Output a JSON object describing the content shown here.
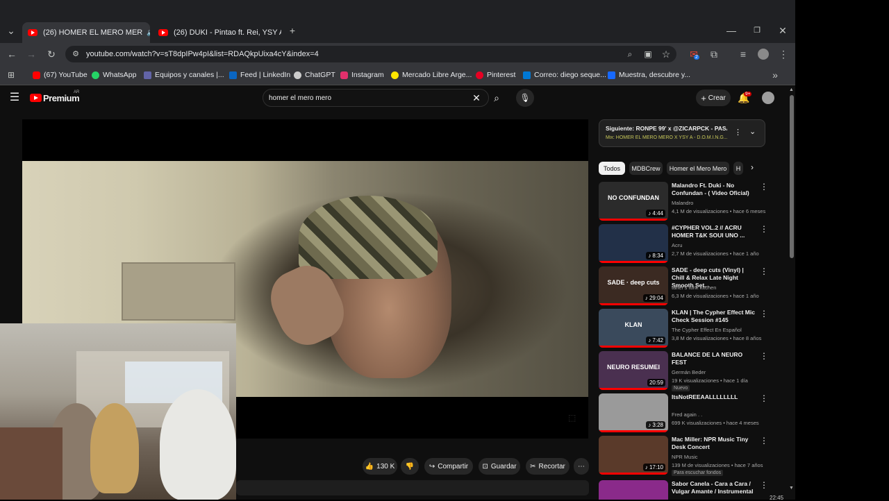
{
  "browser": {
    "tabs": [
      {
        "title": "(26) HOMER EL MERO MER",
        "active": true
      },
      {
        "title": "(26) DUKI - Pintao ft. Rei, YSY A",
        "active": false
      }
    ],
    "url": "youtube.com/watch?v=sT8dpIPw4pI&list=RDAQkpUixa4cY&index=4",
    "bookmarks": [
      "(67) YouTube",
      "WhatsApp",
      "Equipos y canales |...",
      "Feed | LinkedIn",
      "ChatGPT",
      "Instagram",
      "Mercado Libre Arge...",
      "Pinterest",
      "Correo: diego seque...",
      "Muestra, descubre y..."
    ],
    "bookmark_colors": [
      "#ff0000",
      "#25d366",
      "#6264a7",
      "#0a66c2",
      "#cccccc",
      "#e1306c",
      "#ffe600",
      "#e60023",
      "#0078d4",
      "#1769ff"
    ],
    "ext_badge": "2"
  },
  "youtube": {
    "logo_text": "Premium",
    "logo_region": "AR",
    "search_value": "homer el mero mero",
    "create_label": "Crear",
    "notif_count": "9+",
    "actions": {
      "likes": "130 K",
      "share": "Compartir",
      "save": "Guardar",
      "clip": "Recortar"
    },
    "next_up": {
      "title": "Siguiente: RONPE 99' x @ZICARPCK - PASA...",
      "mix": "Mix: HOMER EL MERO MERO X YSY A - D.O.M.I.N.G..."
    },
    "chips": [
      "Todos",
      "MDBCrew",
      "Homer el Mero Mero",
      "H"
    ],
    "recommendations": [
      {
        "title": "Malandro Ft. Duki - No Confundan - ( Video Oficial)",
        "channel": "Malandro",
        "meta": "4,1 M de visualizaciones • hace 6 meses",
        "duration": "♪ 4:44",
        "thumb_text": "NO CONFUNDAN",
        "badge": ""
      },
      {
        "title": "#CYPHER VOL.2 // ACRU HOMER T&K SOUI UNO ...",
        "channel": "Acru",
        "meta": "2,7 M de visualizaciones • hace 1 año",
        "duration": "♪ 8:34",
        "thumb_text": "",
        "badge": ""
      },
      {
        "title": "SADE - deep cuts (Vinyl) | Chill & Relax Late Night Smooth Set...",
        "channel": "taner's funk kitchen",
        "meta": "6,3 M de visualizaciones • hace 1 año",
        "duration": "♪ 29:04",
        "thumb_text": "SADE · deep cuts",
        "badge": ""
      },
      {
        "title": "KLAN | The Cypher Effect Mic Check Session #145",
        "channel": "The Cypher Effect En Español",
        "meta": "3,8 M de visualizaciones • hace 8 años",
        "duration": "♪ 7:42",
        "thumb_text": "KLAN",
        "badge": ""
      },
      {
        "title": "BALANCE DE LA NEURO FEST",
        "channel": "Germán Beder",
        "meta": "19 K visualizaciones • hace 1 día",
        "duration": "20:59",
        "thumb_text": "NEURO RESUMEI",
        "badge": "Nuevo"
      },
      {
        "title": "ItsNotREEAALLLLLLLL",
        "channel": "Fred again . .",
        "meta": "699 K visualizaciones • hace 4 meses",
        "duration": "♪ 3:28",
        "thumb_text": "",
        "badge": ""
      },
      {
        "title": "Mac Miller: NPR Music Tiny Desk Concert",
        "channel": "NPR Music",
        "meta": "139 M de visualizaciones • hace 7 años",
        "duration": "♪ 17:10",
        "thumb_text": "",
        "badge": "Para escuchar fondos"
      },
      {
        "title": "Sabor Canela - Cara a Cara / Vulgar Amante / Instrumental",
        "channel": "",
        "meta": "",
        "duration": "",
        "thumb_text": "",
        "badge": ""
      }
    ],
    "thumb_colors": [
      "#2b2b2b",
      "#223048",
      "#3b2a22",
      "#3a4a5c",
      "#4a3050",
      "#9a9a9a",
      "#5a3a2a",
      "#8a2a8a"
    ]
  },
  "taskbar_time": "22:45"
}
